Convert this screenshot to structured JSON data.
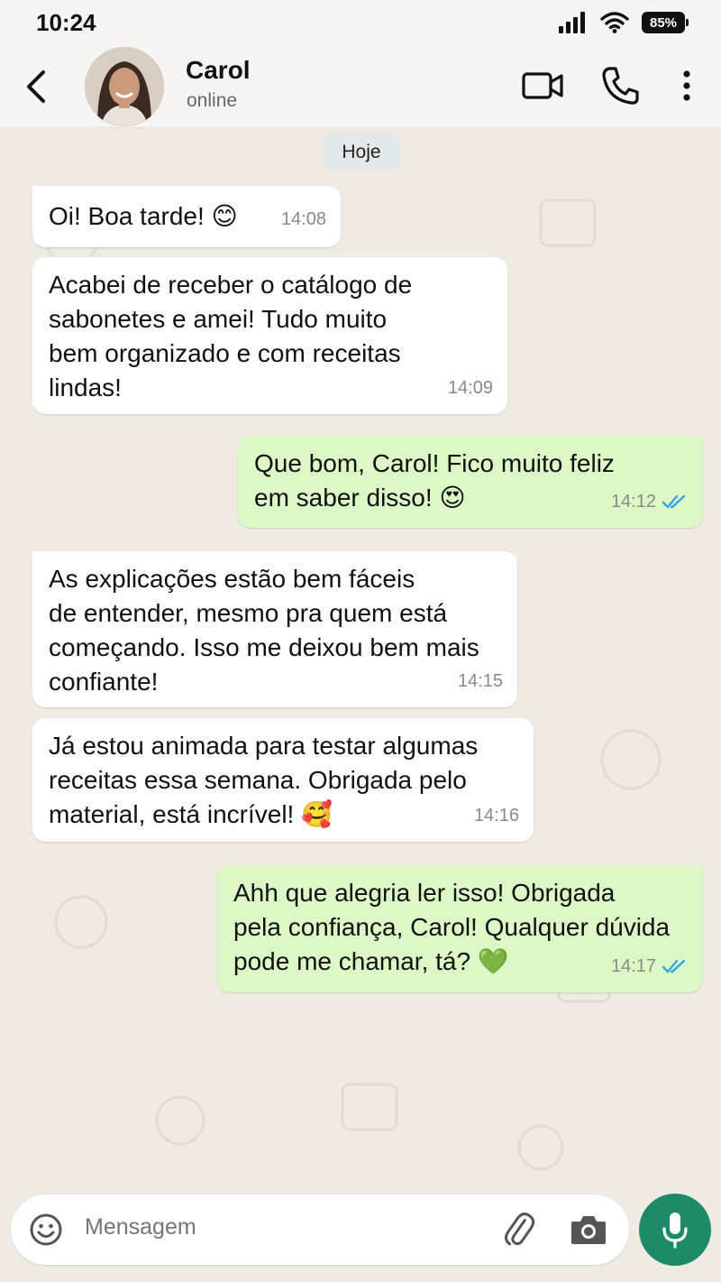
{
  "status_bar": {
    "time": "10:24",
    "battery": "85%"
  },
  "header": {
    "contact_name": "Carol",
    "contact_status": "online"
  },
  "chat": {
    "date_label": "Hoje",
    "messages": [
      {
        "direction": "in",
        "text": "Oi! Boa tarde! ",
        "emoji": "😊",
        "time": "14:08"
      },
      {
        "direction": "in",
        "text": "Acabei de receber o catálogo de\nsabonetes e amei! Tudo muito\nbem organizado e com receitas\nlindas!",
        "time": "14:09"
      },
      {
        "direction": "out",
        "text": "Que bom, Carol! Fico muito feliz\nem saber disso! ",
        "emoji": "😍",
        "time": "14:12",
        "read": true
      },
      {
        "direction": "in",
        "text": "As explicações estão bem fáceis\nde entender, mesmo pra quem está\ncomeçando. Isso me deixou bem mais\nconfiante!",
        "time": "14:15"
      },
      {
        "direction": "in",
        "text": "Já estou animada para testar algumas\nreceitas essa semana. Obrigada pelo\nmaterial, está incrível! ",
        "emoji": "🥰",
        "time": "14:16"
      },
      {
        "direction": "out",
        "text": "Ahh que alegria ler isso! Obrigada\npela confiança, Carol! Qualquer dúvida\npode me chamar, tá? ",
        "emoji": "💚",
        "time": "14:17",
        "read": true
      }
    ]
  },
  "composer": {
    "placeholder": "Mensagem"
  },
  "colors": {
    "chat_background": "#efeae2",
    "incoming_bubble": "#ffffff",
    "outgoing_bubble": "#dcf8c6",
    "read_ticks": "#34a4e0",
    "mic_button": "#1f8a68"
  },
  "icons": [
    "back-arrow-icon",
    "video-call-icon",
    "phone-icon",
    "more-vertical-icon",
    "emoji-icon",
    "attach-icon",
    "camera-icon",
    "mic-icon",
    "signal-icon",
    "wifi-icon",
    "double-check-icon"
  ]
}
